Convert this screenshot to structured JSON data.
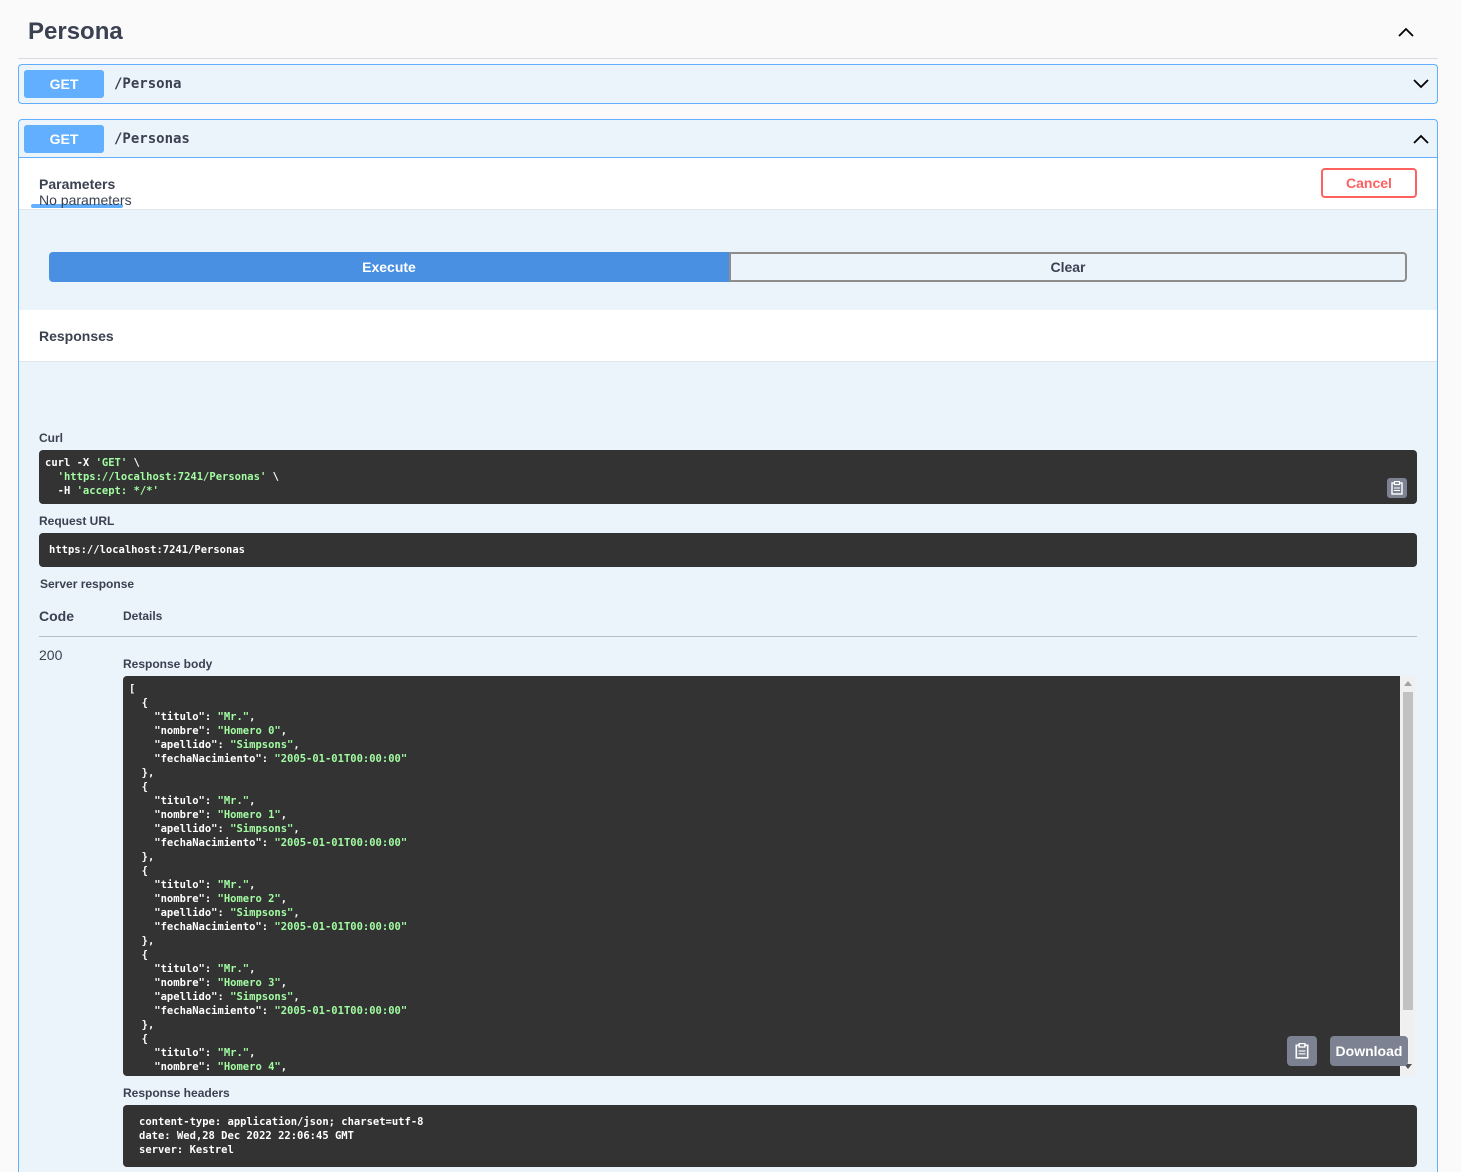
{
  "section": {
    "title": "Persona"
  },
  "endpoints": [
    {
      "method": "GET",
      "path": "/Persona"
    },
    {
      "method": "GET",
      "path": "/Personas"
    }
  ],
  "tabs": {
    "parameters": "Parameters",
    "cancel": "Cancel"
  },
  "parameters": {
    "none_text": "No parameters"
  },
  "actions": {
    "execute": "Execute",
    "clear": "Clear"
  },
  "responses": {
    "title": "Responses",
    "curl_label": "Curl",
    "curl": {
      "line1_cmd": "curl -X ",
      "line1_method": "'GET'",
      "line1_end": " \\",
      "line2_url": "'https://localhost:7241/Personas'",
      "line2_end": " \\",
      "line3_flag": "  -H ",
      "line3_header": "'accept: */*'"
    },
    "request_url_label": "Request URL",
    "request_url": "https://localhost:7241/Personas",
    "server_response_label": "Server response",
    "code_header": "Code",
    "details_header": "Details",
    "status_code": "200",
    "response_body_label": "Response body",
    "response_items": [
      {
        "titulo": "\"Mr.\"",
        "nombre": "\"Homero 0\"",
        "apellido": "\"Simpsons\"",
        "fechaNacimiento": "\"2005-01-01T00:00:00\""
      },
      {
        "titulo": "\"Mr.\"",
        "nombre": "\"Homero 1\"",
        "apellido": "\"Simpsons\"",
        "fechaNacimiento": "\"2005-01-01T00:00:00\""
      },
      {
        "titulo": "\"Mr.\"",
        "nombre": "\"Homero 2\"",
        "apellido": "\"Simpsons\"",
        "fechaNacimiento": "\"2005-01-01T00:00:00\""
      },
      {
        "titulo": "\"Mr.\"",
        "nombre": "\"Homero 3\"",
        "apellido": "\"Simpsons\"",
        "fechaNacimiento": "\"2005-01-01T00:00:00\""
      },
      {
        "titulo": "\"Mr.\"",
        "nombre": "\"Homero 4\""
      }
    ],
    "download_label": "Download",
    "response_headers_label": "Response headers",
    "headers": [
      "content-type: application/json; charset=utf-8",
      "date: Wed,28 Dec 2022 22:06:45 GMT",
      "server: Kestrel"
    ]
  },
  "icons": {
    "section_toggle": "chevron-up-icon",
    "collapsed": "chevron-down-icon",
    "expanded": "chevron-up-icon",
    "copy": "clipboard-icon"
  },
  "colors": {
    "get": "#61affe",
    "execute": "#4990e2",
    "cancel": "#ff6060",
    "code_bg": "#333333",
    "string": "#a2fca2"
  }
}
